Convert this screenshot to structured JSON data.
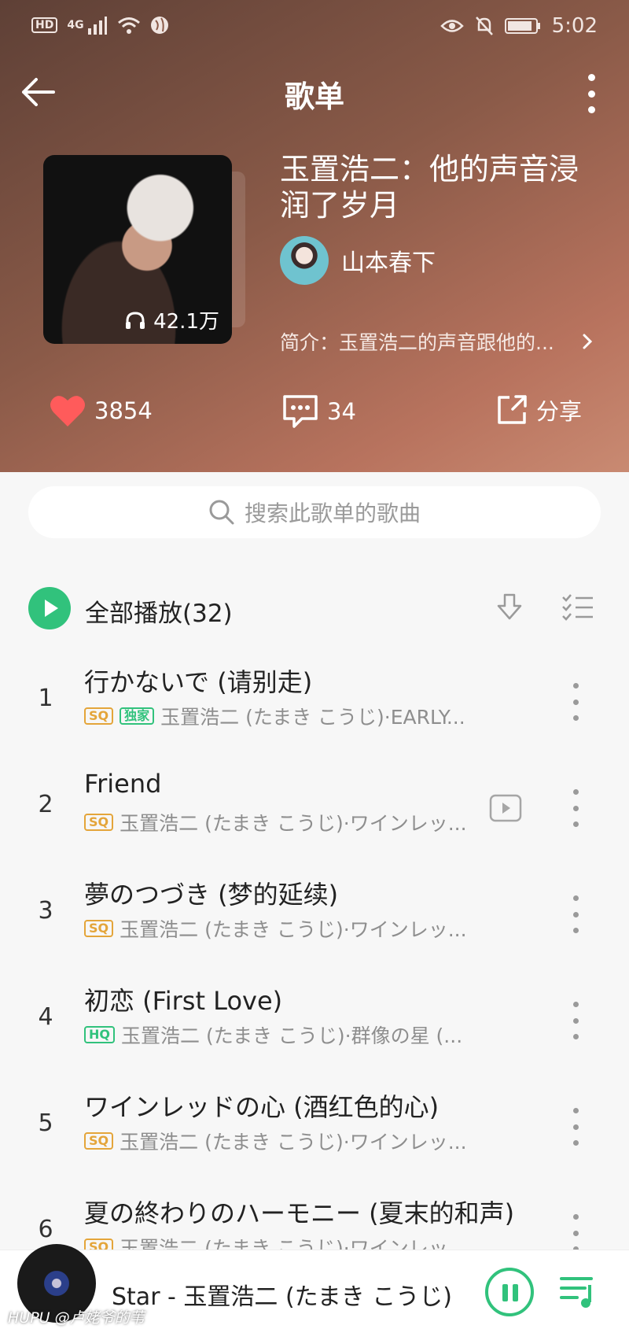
{
  "status_bar": {
    "time": "5:02",
    "hd_label": "HD",
    "network_label": "4G"
  },
  "topbar": {
    "title": "歌单"
  },
  "playlist": {
    "title": "玉置浩二：他的声音浸润了岁月",
    "play_count": "42.1万",
    "author": "山本春下",
    "intro": "简介：玉置浩二的声音跟他的..."
  },
  "actions": {
    "likes": "3854",
    "comments": "34",
    "share_label": "分享"
  },
  "search": {
    "placeholder": "搜索此歌单的歌曲"
  },
  "play_all": {
    "label": "全部播放(32)"
  },
  "songs": [
    {
      "num": "1",
      "name": "行かないで (请别走)",
      "quality": "SQ",
      "exclusive": "独家",
      "meta": "玉置浩二 (たまき こうじ)·EARLY...",
      "has_mv": false
    },
    {
      "num": "2",
      "name": "Friend",
      "quality": "SQ",
      "meta": "玉置浩二 (たまき こうじ)·ワインレッ...",
      "has_mv": true
    },
    {
      "num": "3",
      "name": "夢のつづき (梦的延续)",
      "quality": "SQ",
      "meta": "玉置浩二 (たまき こうじ)·ワインレッ...",
      "has_mv": false
    },
    {
      "num": "4",
      "name": "初恋 (First Love)",
      "quality": "HQ",
      "meta": "玉置浩二 (たまき こうじ)·群像の星 (...",
      "has_mv": false
    },
    {
      "num": "5",
      "name": "ワインレッドの心 (酒红色的心)",
      "quality": "SQ",
      "meta": "玉置浩二 (たまき こうじ)·ワインレッ...",
      "has_mv": false
    },
    {
      "num": "6",
      "name": "夏の終わりのハーモニー (夏末的和声)",
      "quality": "SQ",
      "meta": "玉置浩二 (たまき こうじ)·ワインレッ...",
      "has_mv": false
    }
  ],
  "player": {
    "now_playing": "Star - 玉置浩二 (たまき こうじ)"
  },
  "watermark": "HUPU @卢姥爷的苇",
  "colors": {
    "accent": "#31c27c",
    "sq": "#e4a53a",
    "like": "#ff5b5b"
  }
}
